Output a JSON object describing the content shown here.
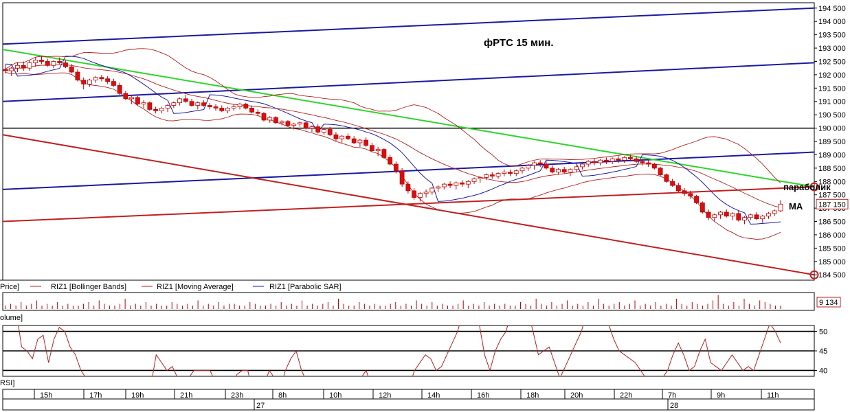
{
  "chart_data": {
    "type": "candlestick",
    "instrument": "RIZ1",
    "title": "фРТС   15 мин.",
    "price_axis": {
      "range": [
        184300,
        194700
      ],
      "ticks": [
        194500,
        194000,
        193500,
        193000,
        192500,
        192000,
        191500,
        191000,
        190500,
        190000,
        189500,
        189000,
        188500,
        188000,
        187500,
        187000,
        186500,
        186000,
        185500,
        185000,
        184500
      ],
      "tick_labels": [
        "194 500",
        "194 000",
        "193 500",
        "193 000",
        "192 500",
        "192 000",
        "191 500",
        "191 000",
        "190 500",
        "190 000",
        "189 500",
        "189 000",
        "188 500",
        "188 000",
        "187 500",
        "187 000",
        "186 500",
        "186 000",
        "185 500",
        "185 000",
        "184 500"
      ],
      "last_price": 187150,
      "last_price_label": "187 150"
    },
    "time_axis": {
      "hour_labels": [
        "15h",
        "17h",
        "19h",
        "21h",
        "23h",
        "8h",
        "10h",
        "12h",
        "14h",
        "16h",
        "18h",
        "20h",
        "22h",
        "7h",
        "9h",
        "11h"
      ],
      "day_labels": [
        "27",
        "28"
      ]
    },
    "candles": [
      [
        192200,
        192400,
        192050,
        192150
      ],
      [
        192150,
        192300,
        191950,
        192250
      ],
      [
        192250,
        192450,
        192100,
        192350
      ],
      [
        192350,
        192500,
        192150,
        192250
      ],
      [
        192250,
        192550,
        192150,
        192450
      ],
      [
        192450,
        192650,
        192300,
        192550
      ],
      [
        192550,
        192700,
        192400,
        192500
      ],
      [
        192500,
        192600,
        192300,
        192350
      ],
      [
        192350,
        192550,
        192250,
        192500
      ],
      [
        192500,
        192650,
        192400,
        192450
      ],
      [
        192450,
        192550,
        192250,
        192300
      ],
      [
        192300,
        192400,
        192050,
        192100
      ],
      [
        192100,
        192200,
        191750,
        191800
      ],
      [
        191800,
        191900,
        191450,
        191650
      ],
      [
        191650,
        191850,
        191550,
        191800
      ],
      [
        191800,
        191950,
        191700,
        191900
      ],
      [
        191900,
        192000,
        191750,
        191850
      ],
      [
        191850,
        191950,
        191650,
        191750
      ],
      [
        191750,
        191850,
        191550,
        191600
      ],
      [
        191600,
        191700,
        191250,
        191300
      ],
      [
        191300,
        191400,
        191050,
        191100
      ],
      [
        191100,
        191250,
        190900,
        191150
      ],
      [
        191150,
        191200,
        190850,
        190900
      ],
      [
        190900,
        191050,
        190750,
        190950
      ],
      [
        190950,
        191000,
        190650,
        190700
      ],
      [
        190700,
        190800,
        190550,
        190650
      ],
      [
        190650,
        190800,
        190550,
        190750
      ],
      [
        190750,
        190900,
        190600,
        190850
      ],
      [
        190850,
        191000,
        190750,
        190950
      ],
      [
        190950,
        191150,
        190850,
        191100
      ],
      [
        191100,
        191250,
        190950,
        191000
      ],
      [
        191000,
        191100,
        190800,
        190850
      ],
      [
        190850,
        191000,
        190700,
        190950
      ],
      [
        190950,
        191050,
        190800,
        190850
      ],
      [
        190850,
        190950,
        190700,
        190800
      ],
      [
        190800,
        190900,
        190650,
        190750
      ],
      [
        190750,
        190850,
        190600,
        190650
      ],
      [
        190650,
        190800,
        190550,
        190750
      ],
      [
        190750,
        190900,
        190650,
        190800
      ],
      [
        190800,
        190950,
        190700,
        190900
      ],
      [
        190900,
        190950,
        190700,
        190750
      ],
      [
        190750,
        190850,
        190550,
        190600
      ],
      [
        190600,
        190700,
        190450,
        190550
      ],
      [
        190550,
        190600,
        190250,
        190300
      ],
      [
        190300,
        190450,
        190200,
        190400
      ],
      [
        190400,
        190450,
        190150,
        190200
      ],
      [
        190200,
        190300,
        190100,
        190250
      ],
      [
        190250,
        190300,
        190050,
        190100
      ],
      [
        190100,
        190200,
        189950,
        190150
      ],
      [
        190150,
        190250,
        190050,
        190200
      ],
      [
        190200,
        190250,
        189950,
        190000
      ],
      [
        190000,
        190100,
        189850,
        190050
      ],
      [
        190050,
        190150,
        189800,
        189850
      ],
      [
        189850,
        190000,
        189750,
        189950
      ],
      [
        189950,
        190050,
        189700,
        189750
      ],
      [
        189750,
        189850,
        189500,
        189600
      ],
      [
        189600,
        189750,
        189450,
        189700
      ],
      [
        189700,
        189800,
        189550,
        189600
      ],
      [
        189600,
        189700,
        189400,
        189450
      ],
      [
        189450,
        189600,
        189300,
        189550
      ],
      [
        189550,
        189650,
        189300,
        189350
      ],
      [
        189350,
        189450,
        189100,
        189150
      ],
      [
        189150,
        189300,
        188950,
        189200
      ],
      [
        189200,
        189250,
        188850,
        188900
      ],
      [
        188900,
        189000,
        188600,
        188650
      ],
      [
        188650,
        188750,
        188300,
        188400
      ],
      [
        188400,
        188500,
        187800,
        187900
      ],
      [
        187900,
        188000,
        187550,
        187650
      ],
      [
        187650,
        187750,
        187300,
        187400
      ],
      [
        187400,
        187600,
        187250,
        187550
      ],
      [
        187550,
        187700,
        187400,
        187600
      ],
      [
        187600,
        187800,
        187500,
        187750
      ],
      [
        187750,
        187850,
        187600,
        187800
      ],
      [
        187800,
        187950,
        187700,
        187900
      ],
      [
        187900,
        188000,
        187750,
        187850
      ],
      [
        187850,
        188000,
        187700,
        187950
      ],
      [
        187950,
        188050,
        187800,
        187900
      ],
      [
        187900,
        188050,
        187750,
        188000
      ],
      [
        188000,
        188150,
        187900,
        188100
      ],
      [
        188100,
        188200,
        187950,
        188150
      ],
      [
        188150,
        188300,
        188050,
        188250
      ],
      [
        188250,
        188350,
        188100,
        188200
      ],
      [
        188200,
        188350,
        188100,
        188300
      ],
      [
        188300,
        188450,
        188200,
        188350
      ],
      [
        188350,
        188450,
        188200,
        188300
      ],
      [
        188300,
        188450,
        188200,
        188400
      ],
      [
        188400,
        188550,
        188300,
        188500
      ],
      [
        188500,
        188650,
        188400,
        188600
      ],
      [
        188600,
        188750,
        188450,
        188700
      ],
      [
        188700,
        188800,
        188550,
        188650
      ],
      [
        188650,
        188750,
        188450,
        188500
      ],
      [
        188500,
        188600,
        188300,
        188350
      ],
      [
        188350,
        188500,
        188250,
        188450
      ],
      [
        188450,
        188550,
        188300,
        188350
      ],
      [
        188350,
        188500,
        188200,
        188450
      ],
      [
        188450,
        188600,
        188350,
        188550
      ],
      [
        188550,
        188700,
        188450,
        188650
      ],
      [
        188650,
        188800,
        188550,
        188750
      ],
      [
        188750,
        188850,
        188600,
        188700
      ],
      [
        188700,
        188850,
        188600,
        188800
      ],
      [
        188800,
        188900,
        188650,
        188750
      ],
      [
        188750,
        188900,
        188650,
        188850
      ],
      [
        188850,
        188950,
        188700,
        188800
      ],
      [
        188800,
        188950,
        188700,
        188900
      ],
      [
        188900,
        189000,
        188750,
        188850
      ],
      [
        188850,
        188950,
        188700,
        188750
      ],
      [
        188750,
        188850,
        188600,
        188700
      ],
      [
        188700,
        188800,
        188550,
        188650
      ],
      [
        188650,
        188700,
        188450,
        188500
      ],
      [
        188500,
        188550,
        188200,
        188250
      ],
      [
        188250,
        188300,
        187950,
        188000
      ],
      [
        188000,
        188100,
        187800,
        187850
      ],
      [
        187850,
        187950,
        187600,
        187650
      ],
      [
        187650,
        187750,
        187450,
        187550
      ],
      [
        187550,
        187650,
        187350,
        187450
      ],
      [
        187450,
        187500,
        187150,
        187200
      ],
      [
        187200,
        187250,
        186800,
        186850
      ],
      [
        186850,
        186950,
        186550,
        186650
      ],
      [
        186650,
        186800,
        186500,
        186750
      ],
      [
        186750,
        186900,
        186600,
        186850
      ],
      [
        186850,
        186950,
        186650,
        186700
      ],
      [
        186700,
        186850,
        186550,
        186800
      ],
      [
        186800,
        186900,
        186500,
        186550
      ],
      [
        186550,
        186700,
        186400,
        186650
      ],
      [
        186650,
        186800,
        186550,
        186750
      ],
      [
        186750,
        186850,
        186550,
        186600
      ],
      [
        186600,
        186750,
        186450,
        186700
      ],
      [
        186700,
        186850,
        186600,
        186800
      ],
      [
        186800,
        186950,
        186700,
        186900
      ],
      [
        186900,
        187300,
        186850,
        187150
      ]
    ],
    "overlays": [
      {
        "name": "RIZ1 [Bollinger Bands]",
        "color": "#b02020"
      },
      {
        "name": "RIZ1 [Moving Average]",
        "color": "#b02020"
      },
      {
        "name": "RIZ1 [Parabolic SAR]",
        "color": "#1a1aa0"
      }
    ],
    "trend_lines": [
      {
        "color": "#1a1aa0",
        "from": [
          0,
          193150
        ],
        "to": [
          1,
          194500
        ]
      },
      {
        "color": "#1a1aa0",
        "from": [
          0,
          191000
        ],
        "to": [
          1,
          192450
        ]
      },
      {
        "color": "#1a1aa0",
        "from": [
          0,
          187700
        ],
        "to": [
          1,
          189100
        ]
      },
      {
        "color": "#000000",
        "from": [
          0,
          190000
        ],
        "to": [
          1,
          190000
        ]
      },
      {
        "color": "#2ed52e",
        "from": [
          0,
          192950
        ],
        "to": [
          1,
          187800
        ]
      },
      {
        "color": "#c02020",
        "from": [
          0,
          186500
        ],
        "to": [
          1,
          187800
        ]
      },
      {
        "color": "#c02020",
        "from": [
          0,
          189750
        ],
        "to": [
          1,
          184500
        ]
      }
    ],
    "annotations": [
      {
        "text": "параболик"
      },
      {
        "text": "MA"
      }
    ],
    "volume_panel": {
      "label": "Volume",
      "last_value": "9 134",
      "values": [
        2,
        3,
        2,
        4,
        2,
        3,
        5,
        2,
        3,
        2,
        4,
        2,
        3,
        2,
        2,
        3,
        4,
        2,
        5,
        3,
        2,
        2,
        3,
        6,
        2,
        3,
        2,
        4,
        2,
        3,
        2,
        2,
        4,
        3,
        2,
        3,
        2,
        5,
        2,
        3,
        2,
        4,
        2,
        3,
        3,
        2,
        2,
        4,
        3,
        2,
        2,
        3,
        2,
        4,
        2,
        3,
        2,
        5,
        2,
        3,
        2,
        3,
        4,
        2,
        6,
        3,
        2,
        2,
        4,
        3,
        2,
        3,
        2,
        2,
        3,
        4,
        2,
        3,
        2,
        5,
        3,
        2,
        4,
        2,
        3,
        2,
        2,
        3,
        5,
        2,
        3,
        2,
        4,
        2,
        3,
        2,
        3,
        2,
        2,
        4,
        3,
        2,
        6,
        3,
        2,
        4,
        2,
        3,
        5,
        2,
        3,
        2,
        4,
        2,
        6,
        3,
        2,
        3,
        4,
        2,
        3,
        5,
        2,
        3,
        2,
        4,
        2,
        3,
        2,
        6,
        3,
        2,
        4,
        3,
        2,
        3,
        5,
        8,
        3,
        2,
        4,
        2,
        6,
        3,
        2,
        5,
        4,
        3,
        2,
        2
      ]
    },
    "rsi_panel": {
      "label": "RSI",
      "range": [
        38.5,
        51.5
      ],
      "levels": [
        50,
        45,
        40
      ],
      "tick_labels": [
        "50",
        "45",
        "40"
      ],
      "values": [
        61,
        58,
        55,
        46,
        45,
        43,
        48,
        49,
        42,
        48,
        51,
        50,
        46,
        44,
        40,
        38,
        32,
        30,
        28,
        34,
        36,
        30,
        28,
        31,
        35,
        30,
        29,
        36,
        44,
        42,
        40,
        41,
        38,
        36,
        38,
        40,
        40,
        40,
        40,
        37,
        35,
        32,
        34,
        39,
        40,
        40,
        31,
        33,
        36,
        40,
        38,
        35,
        40,
        43,
        45,
        40,
        37,
        33,
        36,
        38,
        34,
        36,
        33,
        30,
        28,
        35,
        38,
        40,
        36,
        32,
        36,
        33,
        30,
        34,
        38,
        36,
        40,
        42,
        44,
        43,
        40,
        41,
        44,
        47,
        50,
        55,
        58,
        60,
        52,
        44,
        40,
        45,
        48,
        50,
        55,
        58,
        60,
        56,
        50,
        44,
        45,
        46,
        42,
        38,
        41,
        44,
        47,
        50,
        55,
        58,
        61,
        57,
        52,
        48,
        45,
        44,
        43,
        42,
        40,
        38,
        36,
        34,
        38,
        40,
        44,
        47,
        44,
        40,
        41,
        45,
        48,
        42,
        41,
        40,
        42,
        44,
        42,
        40,
        41,
        40,
        44,
        48,
        52,
        50,
        47
      ]
    }
  }
}
